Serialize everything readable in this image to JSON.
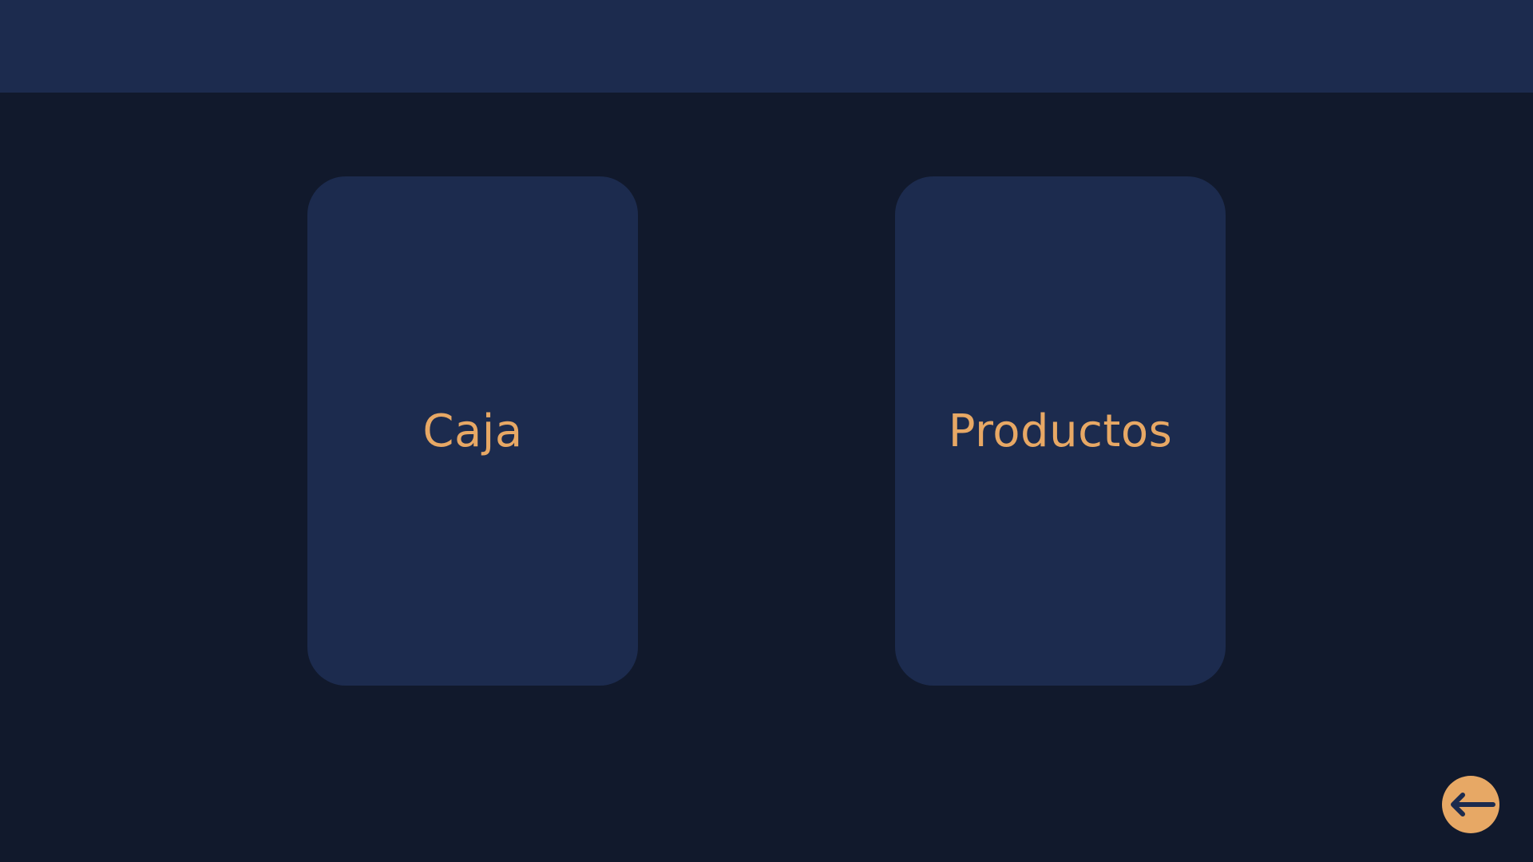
{
  "header": {},
  "cards": {
    "caja": {
      "label": "Caja"
    },
    "productos": {
      "label": "Productos"
    }
  },
  "back_button": {
    "icon": "arrow-left-icon"
  },
  "colors": {
    "background": "#11192c",
    "panel": "#1c2b4e",
    "accent": "#e7a865"
  }
}
